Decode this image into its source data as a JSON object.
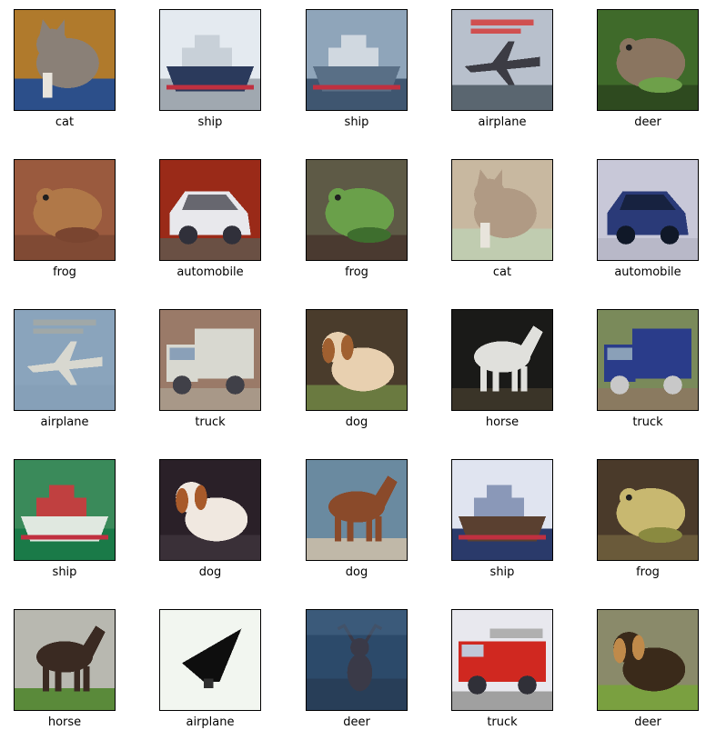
{
  "grid": {
    "items": [
      {
        "label": "cat",
        "scene": "cat",
        "colors": {
          "bg": "#b07a2c",
          "main": "#8a8077",
          "accent": "#3b5b9a",
          "ground": "#2c4f8a"
        }
      },
      {
        "label": "ship",
        "scene": "ship",
        "colors": {
          "bg": "#e4eaf0",
          "main": "#2b3a5c",
          "accent": "#c8d0d8",
          "ground": "#a0a8b0"
        }
      },
      {
        "label": "ship",
        "scene": "ship",
        "colors": {
          "bg": "#8fa5ba",
          "main": "#596f86",
          "accent": "#d0d8e0",
          "ground": "#3f5670"
        }
      },
      {
        "label": "airplane",
        "scene": "airplane",
        "colors": {
          "bg": "#b8c0cc",
          "main": "#3c3c44",
          "accent": "#d05050",
          "ground": "#5a6670"
        }
      },
      {
        "label": "deer",
        "scene": "frog",
        "colors": {
          "bg": "#3f6a2a",
          "main": "#8a7560",
          "accent": "#6ea04a",
          "ground": "#2e4a1f"
        }
      },
      {
        "label": "frog",
        "scene": "frog",
        "colors": {
          "bg": "#9a5a3e",
          "main": "#b07848",
          "accent": "#7a4530",
          "ground": "#804a34"
        }
      },
      {
        "label": "automobile",
        "scene": "car",
        "colors": {
          "bg": "#9a2a18",
          "main": "#e8e8ec",
          "accent": "#30303a",
          "ground": "#6a5044"
        }
      },
      {
        "label": "frog",
        "scene": "frog",
        "colors": {
          "bg": "#5e5a46",
          "main": "#6aa04a",
          "accent": "#3e6e2e",
          "ground": "#4a3a30"
        }
      },
      {
        "label": "cat",
        "scene": "cat",
        "colors": {
          "bg": "#c8b8a0",
          "main": "#b09a84",
          "accent": "#a8c08c",
          "ground": "#c0ccb0"
        }
      },
      {
        "label": "automobile",
        "scene": "car",
        "colors": {
          "bg": "#c8c8d8",
          "main": "#2a3a78",
          "accent": "#101828",
          "ground": "#b8b8c8"
        }
      },
      {
        "label": "airplane",
        "scene": "airplane",
        "colors": {
          "bg": "#8aa4bc",
          "main": "#d8d8d0",
          "accent": "#a0a8a8",
          "ground": "#86a0b8"
        }
      },
      {
        "label": "truck",
        "scene": "truck",
        "colors": {
          "bg": "#9a7a68",
          "main": "#d8d8d0",
          "accent": "#404048",
          "ground": "#a89888"
        }
      },
      {
        "label": "dog",
        "scene": "dog",
        "colors": {
          "bg": "#4a3c2c",
          "main": "#e8d0b0",
          "accent": "#a06030",
          "ground": "#6a7a40"
        }
      },
      {
        "label": "horse",
        "scene": "horse",
        "colors": {
          "bg": "#1a1a18",
          "main": "#e0e0dc",
          "accent": "#505048",
          "ground": "#3a3428"
        }
      },
      {
        "label": "truck",
        "scene": "truck",
        "colors": {
          "bg": "#7a8a5a",
          "main": "#2a3c8a",
          "accent": "#c8c8c8",
          "ground": "#8a7a60"
        }
      },
      {
        "label": "ship",
        "scene": "ship",
        "colors": {
          "bg": "#3a8a5a",
          "main": "#e0e8e0",
          "accent": "#c04040",
          "ground": "#1a7a48"
        }
      },
      {
        "label": "dog",
        "scene": "dog",
        "colors": {
          "bg": "#2a2028",
          "main": "#f0e8e0",
          "accent": "#a85a2a",
          "ground": "#3a3038"
        }
      },
      {
        "label": "dog",
        "scene": "horse",
        "colors": {
          "bg": "#6a8aa0",
          "main": "#8a4a2a",
          "accent": "#d8d0c0",
          "ground": "#c0b8a8"
        }
      },
      {
        "label": "ship",
        "scene": "ship",
        "colors": {
          "bg": "#e0e4f0",
          "main": "#5a4030",
          "accent": "#8a98b8",
          "ground": "#2a3a6a"
        }
      },
      {
        "label": "frog",
        "scene": "frog",
        "colors": {
          "bg": "#4a3a2a",
          "main": "#c8b870",
          "accent": "#8a8a40",
          "ground": "#6a5a3a"
        }
      },
      {
        "label": "horse",
        "scene": "horse",
        "colors": {
          "bg": "#b8b8b0",
          "main": "#3a2a22",
          "accent": "#e8e8e8",
          "ground": "#5a8a3a"
        }
      },
      {
        "label": "airplane",
        "scene": "airplane-dark",
        "colors": {
          "bg": "#f2f6f0",
          "main": "#0e0e0e",
          "accent": "#303030",
          "ground": "#f2f6f0"
        }
      },
      {
        "label": "deer",
        "scene": "deer",
        "colors": {
          "bg": "#2c4a6a",
          "main": "#3a3a48",
          "accent": "#4a6a8a",
          "ground": "#283e58"
        }
      },
      {
        "label": "truck",
        "scene": "firetruck",
        "colors": {
          "bg": "#e8e8ee",
          "main": "#d02820",
          "accent": "#303038",
          "ground": "#a0a0a0"
        }
      },
      {
        "label": "deer",
        "scene": "dog",
        "colors": {
          "bg": "#8a8a6a",
          "main": "#3a2a1a",
          "accent": "#c08a4a",
          "ground": "#7aa040"
        }
      }
    ]
  }
}
